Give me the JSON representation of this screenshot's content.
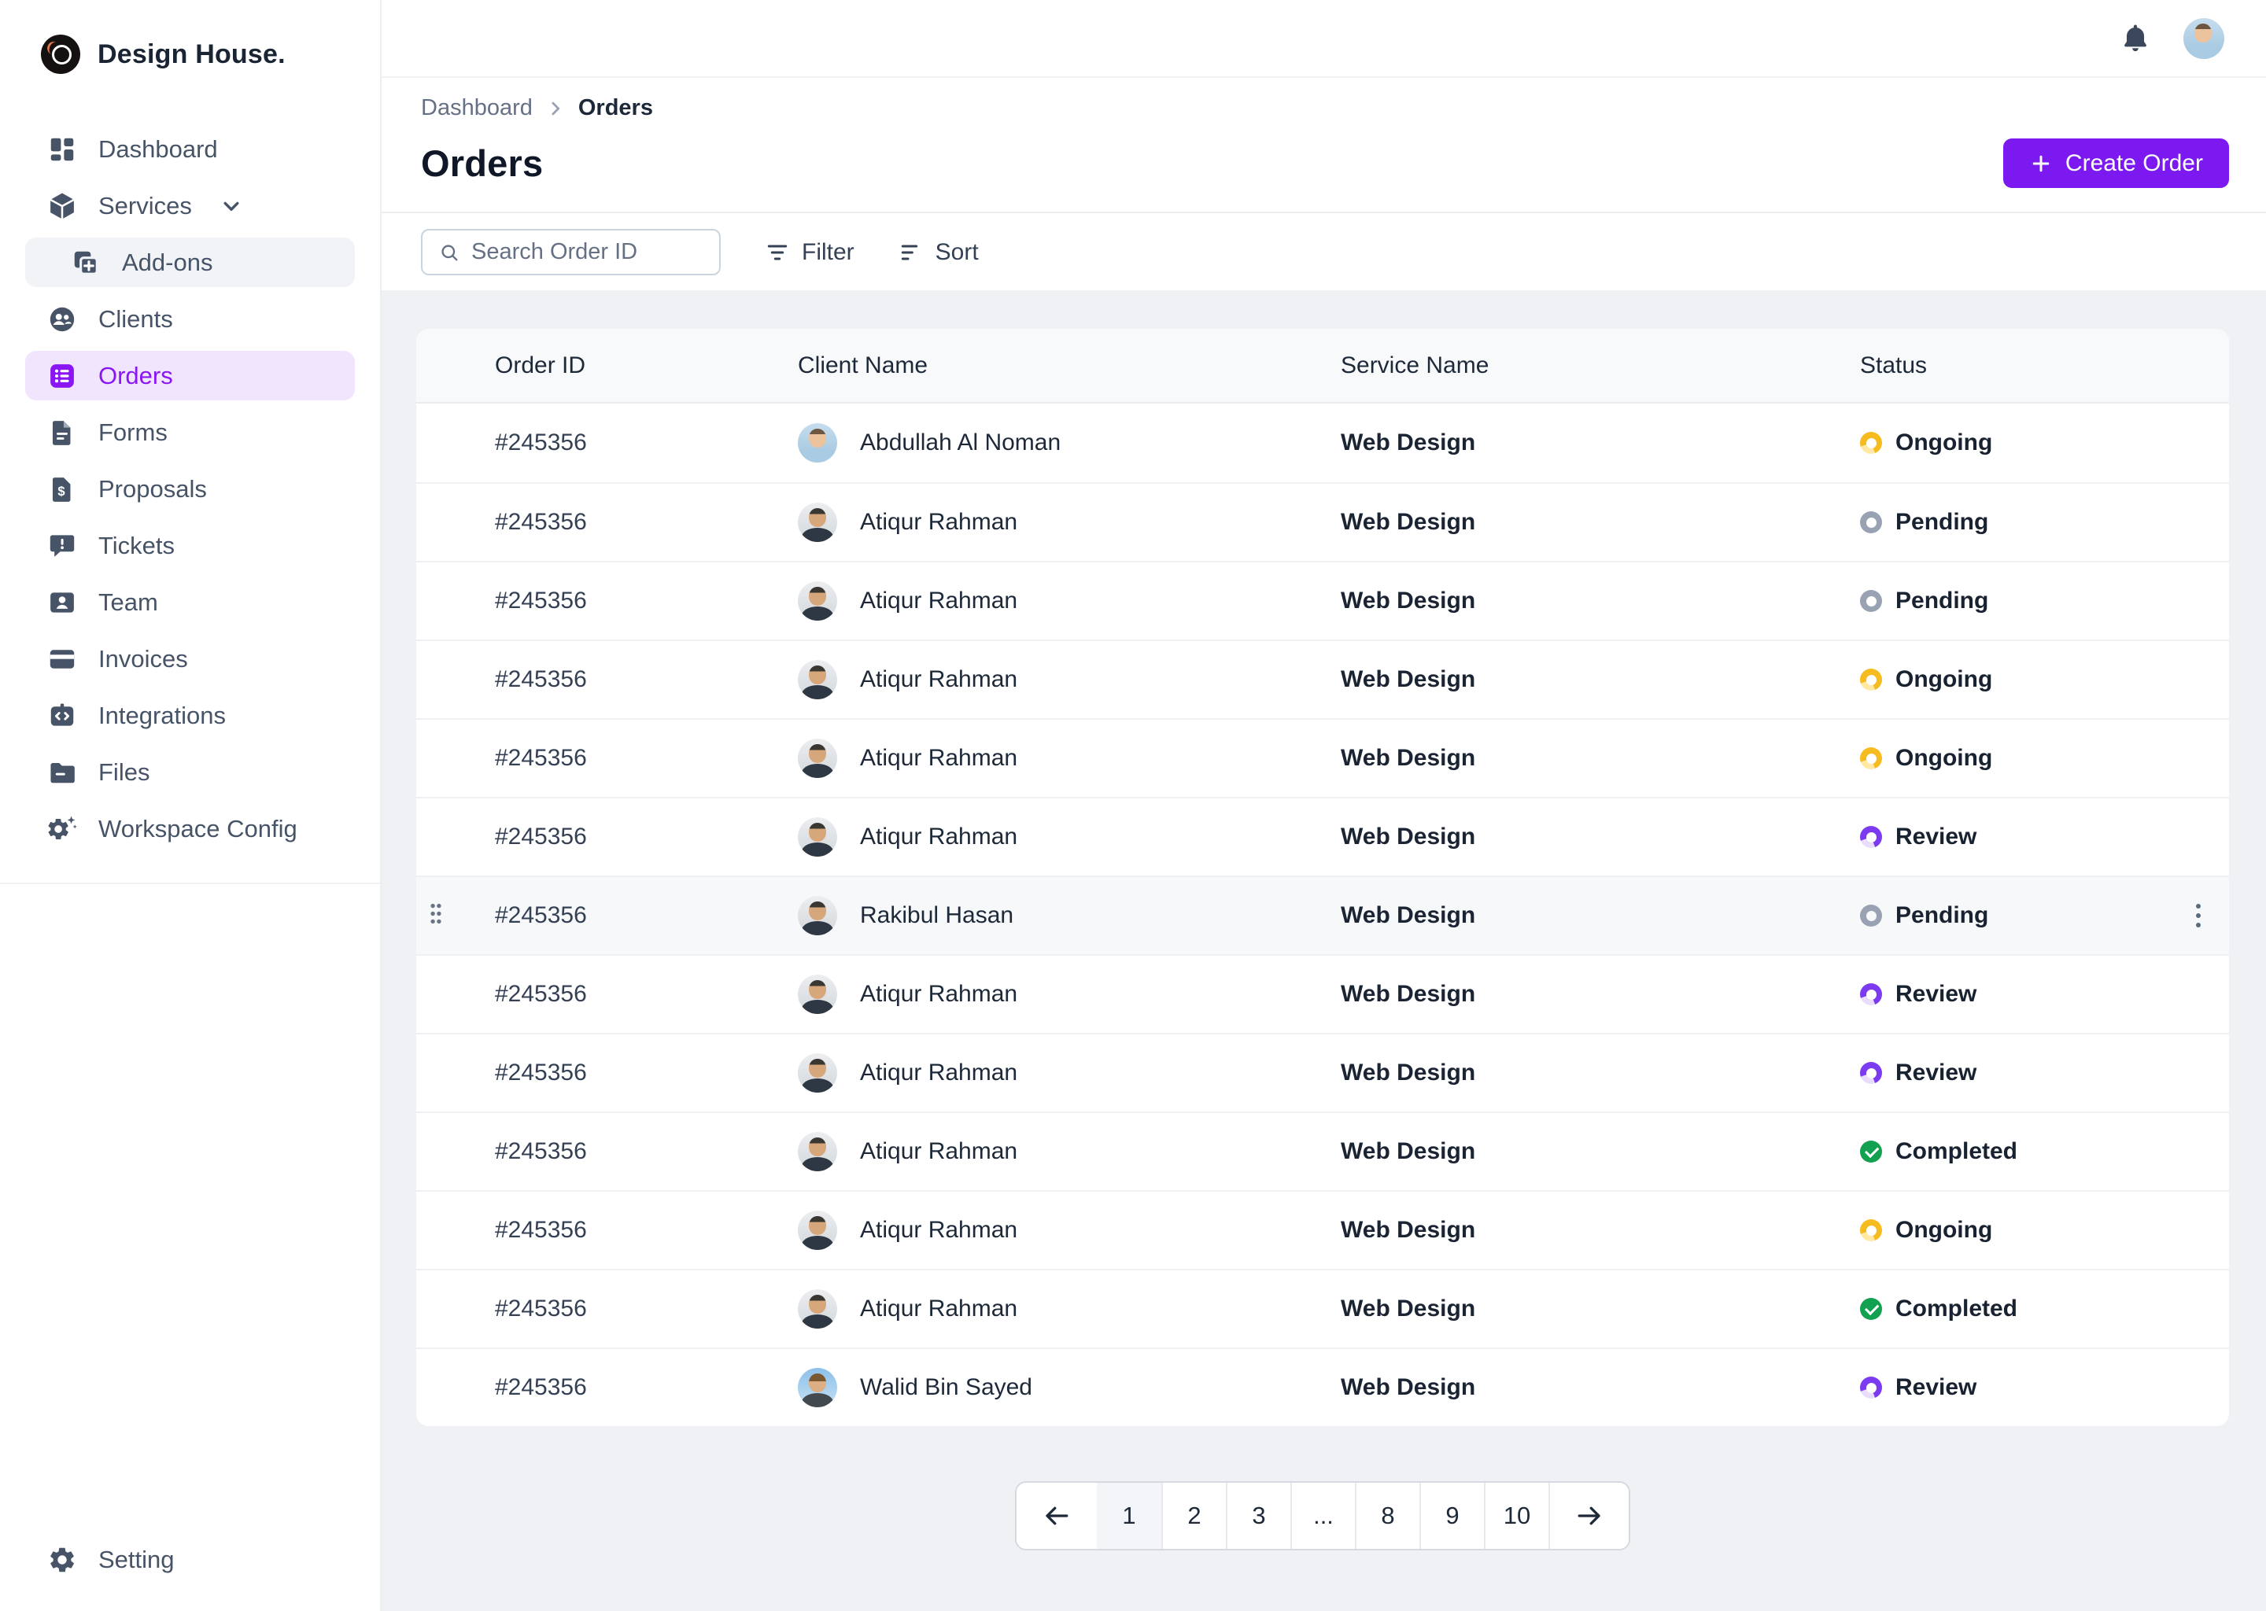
{
  "brand": {
    "name": "Design House."
  },
  "sidebar": {
    "items": [
      {
        "label": "Dashboard"
      },
      {
        "label": "Services"
      },
      {
        "label": "Add-ons"
      },
      {
        "label": "Clients"
      },
      {
        "label": "Orders"
      },
      {
        "label": "Forms"
      },
      {
        "label": "Proposals"
      },
      {
        "label": "Tickets"
      },
      {
        "label": "Team"
      },
      {
        "label": "Invoices"
      },
      {
        "label": "Integrations"
      },
      {
        "label": "Files"
      },
      {
        "label": "Workspace Config"
      }
    ],
    "footer_item": {
      "label": "Setting"
    }
  },
  "breadcrumb": {
    "items": [
      "Dashboard",
      "Orders"
    ]
  },
  "page": {
    "title": "Orders"
  },
  "actions": {
    "create_order_label": "Create Order"
  },
  "toolbar": {
    "search_placeholder": "Search Order ID",
    "filter_label": "Filter",
    "sort_label": "Sort"
  },
  "table": {
    "headers": [
      "Order ID",
      "Client Name",
      "Service Name",
      "Status"
    ],
    "rows": [
      {
        "order_id": "#245356",
        "client": "Abdullah Al Noman",
        "avatar": "av-a",
        "service": "Web Design",
        "status_label": "Ongoing",
        "status_type": "ongoing",
        "row_class": ""
      },
      {
        "order_id": "#245356",
        "client": "Atiqur Rahman",
        "avatar": "av-b",
        "service": "Web Design",
        "status_label": "Pending",
        "status_type": "pending",
        "row_class": ""
      },
      {
        "order_id": "#245356",
        "client": "Atiqur Rahman",
        "avatar": "av-b",
        "service": "Web Design",
        "status_label": "Pending",
        "status_type": "pending",
        "row_class": ""
      },
      {
        "order_id": "#245356",
        "client": "Atiqur Rahman",
        "avatar": "av-b",
        "service": "Web Design",
        "status_label": "Ongoing",
        "status_type": "ongoing",
        "row_class": ""
      },
      {
        "order_id": "#245356",
        "client": "Atiqur Rahman",
        "avatar": "av-b",
        "service": "Web Design",
        "status_label": "Ongoing",
        "status_type": "ongoing",
        "row_class": ""
      },
      {
        "order_id": "#245356",
        "client": "Atiqur Rahman",
        "avatar": "av-b",
        "service": "Web Design",
        "status_label": "Review",
        "status_type": "review",
        "row_class": ""
      },
      {
        "order_id": "#245356",
        "client": "Rakibul Hasan",
        "avatar": "av-b",
        "service": "Web Design",
        "status_label": "Pending",
        "status_type": "pending",
        "row_class": "hovered"
      },
      {
        "order_id": "#245356",
        "client": "Atiqur Rahman",
        "avatar": "av-b",
        "service": "Web Design",
        "status_label": "Review",
        "status_type": "review",
        "row_class": ""
      },
      {
        "order_id": "#245356",
        "client": "Atiqur Rahman",
        "avatar": "av-b",
        "service": "Web Design",
        "status_label": "Review",
        "status_type": "review",
        "row_class": ""
      },
      {
        "order_id": "#245356",
        "client": "Atiqur Rahman",
        "avatar": "av-b",
        "service": "Web Design",
        "status_label": "Completed",
        "status_type": "completed",
        "row_class": ""
      },
      {
        "order_id": "#245356",
        "client": "Atiqur Rahman",
        "avatar": "av-b",
        "service": "Web Design",
        "status_label": "Ongoing",
        "status_type": "ongoing",
        "row_class": ""
      },
      {
        "order_id": "#245356",
        "client": "Atiqur Rahman",
        "avatar": "av-b",
        "service": "Web Design",
        "status_label": "Completed",
        "status_type": "completed",
        "row_class": ""
      },
      {
        "order_id": "#245356",
        "client": "Walid Bin Sayed",
        "avatar": "av-c",
        "service": "Web Design",
        "status_label": "Review",
        "status_type": "review",
        "row_class": ""
      }
    ]
  },
  "pagination": {
    "pages": [
      {
        "label": "1",
        "state": "active"
      },
      {
        "label": "2",
        "state": ""
      },
      {
        "label": "3",
        "state": ""
      },
      {
        "label": "...",
        "state": ""
      },
      {
        "label": "8",
        "state": ""
      },
      {
        "label": "9",
        "state": ""
      },
      {
        "label": "10",
        "state": ""
      }
    ]
  },
  "icons": {
    "logo": "dark-circle-with-white-ring",
    "bell": "bell-icon",
    "search": "magnifier",
    "filter": "filter-lines",
    "sort": "sort-lines",
    "plus": "plus",
    "breadcrumb_separator": "chevron-right",
    "services_expand": "chevron-down",
    "drag_handle": "six-dots",
    "row_menu": "kebab-vertical-dots",
    "prev": "arrow-left",
    "next": "arrow-right",
    "status_ongoing": "amber-spinner-ring",
    "status_pending": "gray-ring",
    "status_review": "violet-spinner-ring",
    "status_completed": "green-check-circle"
  },
  "colors": {
    "accent": "#7C19F0",
    "accent_soft_bg": "#F1E5FE",
    "sidebar_active_text": "#8A16F3",
    "ongoing": "#F6BB1F",
    "pending": "#98A2B3",
    "review": "#7C3BF0",
    "completed": "#12A150",
    "page_bg": "#EFF1F4",
    "table_header_bg": "#F8F9FB",
    "hover_row_bg": "#F7F8FA"
  }
}
